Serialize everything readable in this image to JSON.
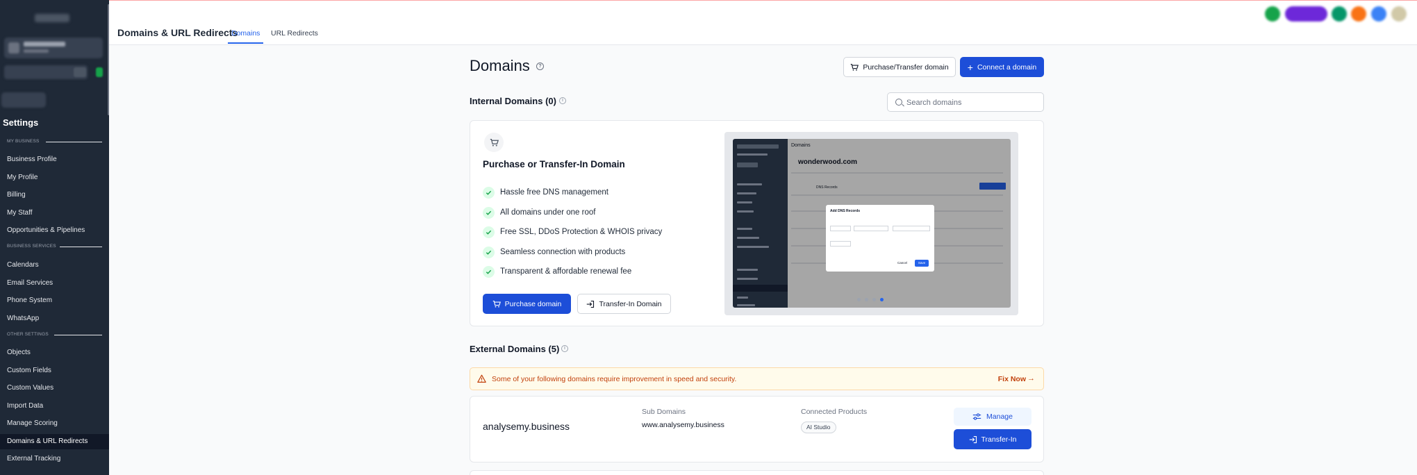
{
  "colors": {
    "accent": "#1d4ed8",
    "sidebar_bg": "#1f2937",
    "warning_text": "#c2410c",
    "warning_bg": "#fffbeb",
    "success_check": "#16a34a"
  },
  "sidebar": {
    "title": "Settings",
    "sections": [
      {
        "label": "MY BUSINESS",
        "items": [
          "Business Profile",
          "My Profile",
          "Billing",
          "My Staff",
          "Opportunities & Pipelines"
        ]
      },
      {
        "label": "BUSINESS SERVICES",
        "items": [
          "Calendars",
          "Email Services",
          "Phone System",
          "WhatsApp"
        ]
      },
      {
        "label": "OTHER SETTINGS",
        "items": [
          "Objects",
          "Custom Fields",
          "Custom Values",
          "Import Data",
          "Manage Scoring",
          "Domains & URL Redirects",
          "External Tracking"
        ]
      }
    ],
    "active_item": "Domains & URL Redirects"
  },
  "header": {
    "title": "Domains & URL Redirects",
    "tabs": [
      {
        "label": "Domains",
        "active": true
      },
      {
        "label": "URL Redirects",
        "active": false
      }
    ]
  },
  "main": {
    "title": "Domains",
    "purchase_transfer_label": "Purchase/Transfer domain",
    "connect_label": "Connect a domain",
    "internal": {
      "title": "Internal Domains (0)",
      "search_placeholder": "Search domains",
      "promo_title": "Purchase or Transfer-In Domain",
      "features": [
        "Hassle free DNS management",
        "All domains under one roof",
        "Free SSL, DDoS Protection & WHOIS privacy",
        "Seamless connection with products",
        "Transparent & affordable renewal fee"
      ],
      "purchase_label": "Purchase domain",
      "transfer_label": "Transfer-In Domain",
      "preview": {
        "heading": "Domains",
        "domain": "wonderwood.com",
        "tab": "DNS Records",
        "modal_title": "Add DNS Records",
        "cancel": "Cancel",
        "save": "Save",
        "slide_count": 4,
        "active_slide": 4
      }
    },
    "external": {
      "title": "External Domains (5)",
      "alert_text": "Some of your following domains require improvement in speed and security.",
      "alert_link": "Fix Now",
      "rows": [
        {
          "name": "analysemy.business",
          "subdomains_label": "Sub Domains",
          "subdomain": "www.analysemy.business",
          "products_label": "Connected Products",
          "product": "AI Studio",
          "manage_label": "Manage",
          "transfer_label": "Transfer-In"
        }
      ]
    }
  }
}
